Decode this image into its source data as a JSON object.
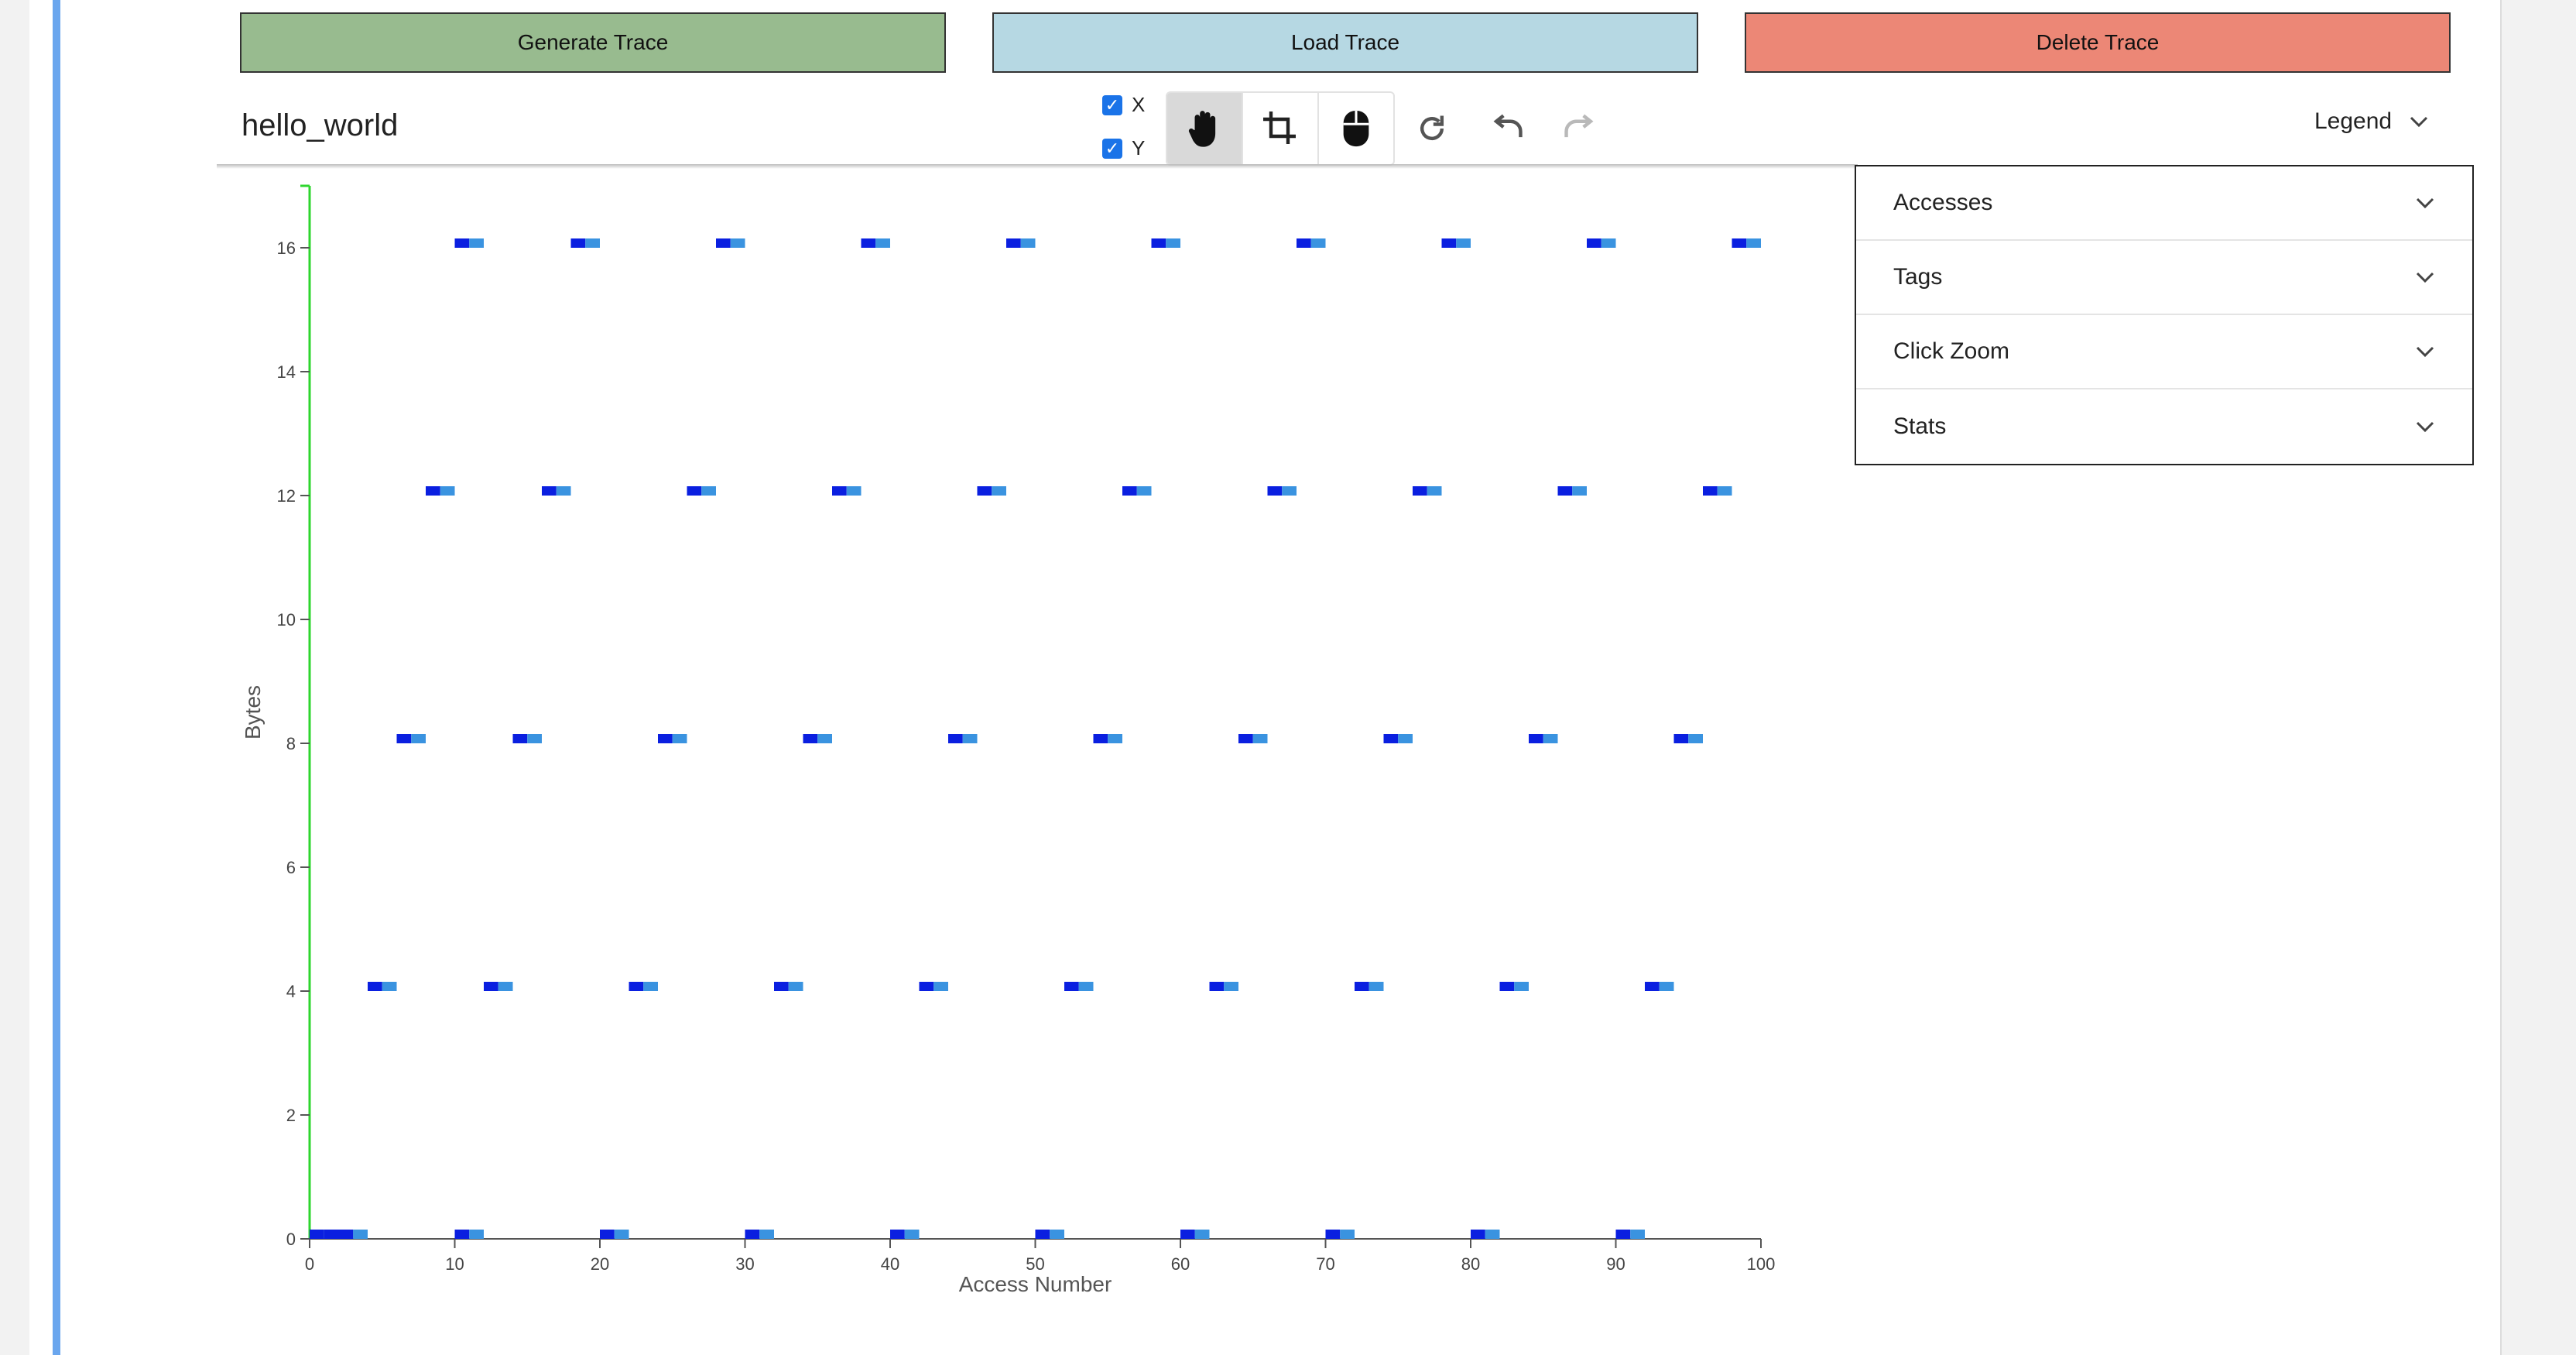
{
  "buttons": {
    "generate": "Generate Trace",
    "load": "Load Trace",
    "delete": "Delete Trace"
  },
  "trace_name": "hello_world",
  "axis_checks": {
    "x_label": "X",
    "y_label": "Y",
    "x_checked": true,
    "y_checked": true
  },
  "toolbar": {
    "mode_icons": [
      "hand-pan-icon",
      "crop-icon",
      "mouse-icon"
    ],
    "active_mode": "hand-pan-icon",
    "action_icons": [
      "refresh-icon",
      "undo-icon",
      "redo-icon"
    ],
    "redo_enabled": false
  },
  "legend": {
    "label": "Legend",
    "sections": [
      "Accesses",
      "Tags",
      "Click Zoom",
      "Stats"
    ]
  },
  "colors": {
    "generate": "#98bb8f",
    "load": "#b6d8e3",
    "delete": "#ec8776",
    "y_axis": "#2ed62e",
    "mark_dark": "#0a1fe0",
    "mark_light": "#3a93e0"
  },
  "chart_data": {
    "type": "scatter",
    "xlabel": "Access Number",
    "ylabel": "Bytes",
    "xlim": [
      0,
      100
    ],
    "ylim": [
      0,
      17
    ],
    "xticks": [
      0,
      10,
      20,
      30,
      40,
      50,
      60,
      70,
      80,
      90,
      100
    ],
    "yticks": [
      0,
      2,
      4,
      6,
      8,
      10,
      12,
      14,
      16
    ],
    "series": [
      {
        "values": [
          [
            0,
            0
          ],
          [
            1,
            0
          ],
          [
            2,
            0
          ],
          [
            4,
            4
          ],
          [
            6,
            8
          ],
          [
            8,
            12
          ],
          [
            10,
            16
          ],
          [
            10,
            0
          ],
          [
            12,
            4
          ],
          [
            14,
            8
          ],
          [
            16,
            12
          ],
          [
            18,
            16
          ],
          [
            20,
            0
          ],
          [
            22,
            4
          ],
          [
            24,
            8
          ],
          [
            26,
            12
          ],
          [
            28,
            16
          ],
          [
            30,
            0
          ],
          [
            32,
            4
          ],
          [
            34,
            8
          ],
          [
            36,
            12
          ],
          [
            38,
            16
          ],
          [
            40,
            0
          ],
          [
            42,
            4
          ],
          [
            44,
            8
          ],
          [
            46,
            12
          ],
          [
            48,
            16
          ],
          [
            50,
            0
          ],
          [
            52,
            4
          ],
          [
            54,
            8
          ],
          [
            56,
            12
          ],
          [
            58,
            16
          ],
          [
            60,
            0
          ],
          [
            62,
            4
          ],
          [
            64,
            8
          ],
          [
            66,
            12
          ],
          [
            68,
            16
          ],
          [
            70,
            0
          ],
          [
            72,
            4
          ],
          [
            74,
            8
          ],
          [
            76,
            12
          ],
          [
            78,
            16
          ],
          [
            80,
            0
          ],
          [
            82,
            4
          ],
          [
            84,
            8
          ],
          [
            86,
            12
          ],
          [
            88,
            16
          ],
          [
            90,
            0
          ],
          [
            92,
            4
          ],
          [
            94,
            8
          ],
          [
            96,
            12
          ],
          [
            98,
            16
          ]
        ]
      }
    ]
  }
}
